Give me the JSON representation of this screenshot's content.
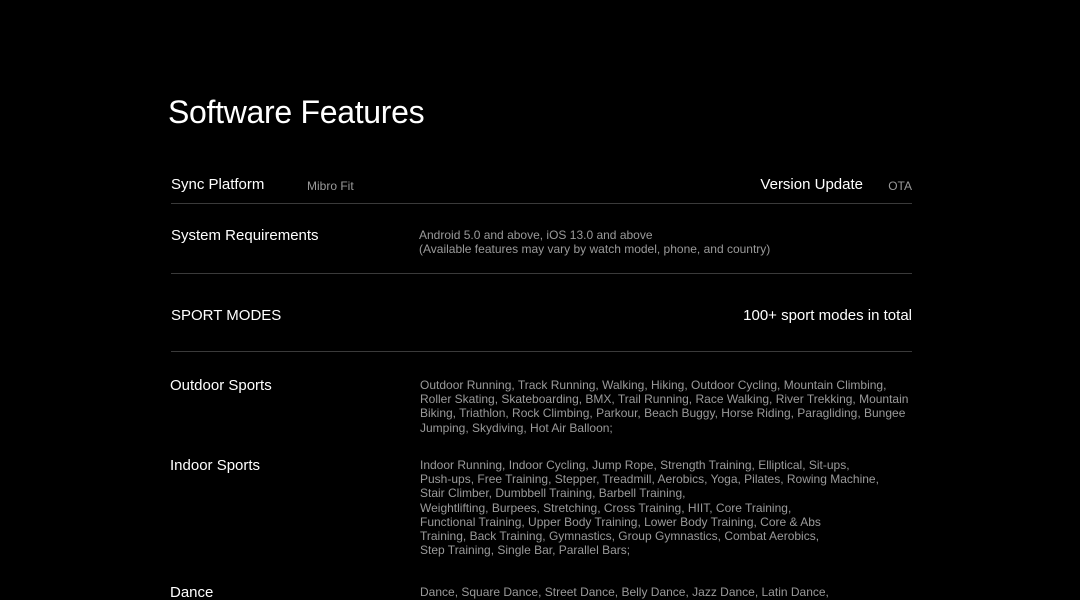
{
  "title": "Software Features",
  "sync": {
    "label": "Sync Platform",
    "value": "Mibro Fit"
  },
  "version": {
    "label": "Version Update",
    "value": "OTA"
  },
  "system": {
    "label": "System Requirements",
    "lines": [
      "Android 5.0 and above, iOS 13.0 and above",
      "(Available features may vary by watch model, phone, and country)"
    ]
  },
  "sport_modes": {
    "label": "SPORT MODES",
    "total": "100+ sport modes in total"
  },
  "outdoor": {
    "label": "Outdoor Sports",
    "lines": [
      "Outdoor Running, Track Running, Walking, Hiking, Outdoor Cycling, Mountain Climbing,",
      "Roller Skating, Skateboarding, BMX, Trail Running, Race Walking, River Trekking, Mountain",
      "Biking, Triathlon, Rock Climbing, Parkour, Beach Buggy, Horse Riding, Paragliding, Bungee",
      "Jumping, Skydiving, Hot Air Balloon;"
    ]
  },
  "indoor": {
    "label": "Indoor Sports",
    "lines": [
      "Indoor Running, Indoor Cycling, Jump Rope, Strength Training, Elliptical, Sit-ups,",
      "Push-ups, Free Training, Stepper, Treadmill, Aerobics, Yoga, Pilates, Rowing Machine,",
      "Stair Climber, Dumbbell Training, Barbell Training,",
      "Weightlifting, Burpees, Stretching, Cross Training, HIIT, Core Training,",
      "Functional Training, Upper Body Training, Lower Body Training, Core & Abs",
      "Training, Back Training, Gymnastics, Group Gymnastics, Combat Aerobics,",
      "Step Training, Single Bar, Parallel Bars;"
    ]
  },
  "dance": {
    "label": "Dance",
    "lines": [
      "Dance, Square Dance, Street Dance, Belly Dance, Jazz Dance, Latin Dance,"
    ]
  },
  "colors": {
    "background": "#000000",
    "text": "#ffffff",
    "muted": "#9a9a9a",
    "divider": "#3a3a3a"
  }
}
